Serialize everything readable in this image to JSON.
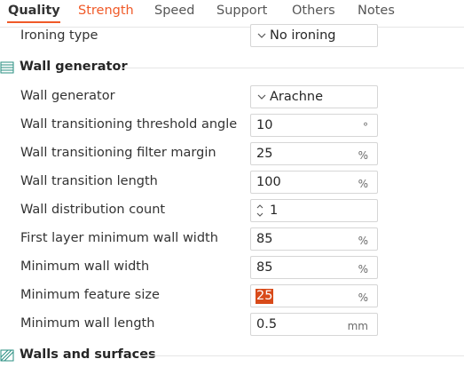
{
  "tabs": [
    {
      "label": "Quality",
      "state": "active"
    },
    {
      "label": "Strength",
      "state": "highlight"
    },
    {
      "label": "Speed",
      "state": "normal"
    },
    {
      "label": "Support",
      "state": "normal"
    },
    {
      "label": "Others",
      "state": "normal"
    },
    {
      "label": "Notes",
      "state": "normal"
    }
  ],
  "accent_color": "#f05a28",
  "ironing": {
    "label": "Ironing type",
    "value": "No ironing"
  },
  "wall_generator_section": {
    "title": "Wall generator",
    "icon": "wall-generator-icon",
    "settings": [
      {
        "label": "Wall generator",
        "value": "Arachne",
        "unit": "",
        "kind": "combo"
      },
      {
        "label": "Wall transitioning threshold angle",
        "value": "10",
        "unit": "°",
        "kind": "text"
      },
      {
        "label": "Wall transitioning filter margin",
        "value": "25",
        "unit": "%",
        "kind": "text"
      },
      {
        "label": "Wall transition length",
        "value": "100",
        "unit": "%",
        "kind": "text"
      },
      {
        "label": "Wall distribution count",
        "value": "1",
        "unit": "",
        "kind": "spin"
      },
      {
        "label": "First layer minimum wall width",
        "value": "85",
        "unit": "%",
        "kind": "text"
      },
      {
        "label": "Minimum wall width",
        "value": "85",
        "unit": "%",
        "kind": "text"
      },
      {
        "label": "Minimum feature size",
        "value": "25",
        "unit": "%",
        "kind": "text",
        "selected": true
      },
      {
        "label": "Minimum wall length",
        "value": "0.5",
        "unit": "mm",
        "kind": "text"
      }
    ]
  },
  "walls_surfaces_section": {
    "title": "Walls and surfaces",
    "icon": "walls-surfaces-icon"
  }
}
